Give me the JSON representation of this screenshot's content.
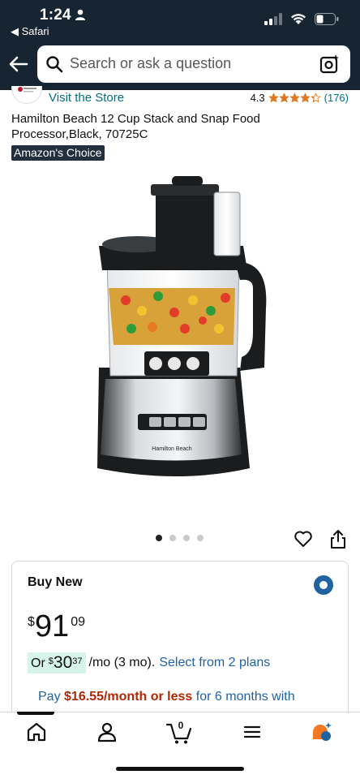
{
  "status_bar": {
    "time": "1:24",
    "back_app": "◀ Safari"
  },
  "search": {
    "placeholder": "Search or ask a question"
  },
  "store": {
    "link": "Visit the Store"
  },
  "rating": {
    "value": "4.3",
    "stars": 4.3,
    "count": "(176)"
  },
  "product": {
    "title": "Hamilton Beach 12 Cup Stack and Snap Food Processor,Black, 70725C",
    "badge": "Amazon's Choice",
    "image_brand": "Hamilton Beach",
    "image_count": 4,
    "image_current": 1
  },
  "buy_box": {
    "title": "Buy New",
    "price": {
      "symbol": "$",
      "whole": "91",
      "fraction": "09"
    },
    "monthly": {
      "prefix": "Or",
      "symbol": "$",
      "whole": "30",
      "fraction": "37",
      "suffix": "/mo (3 mo).",
      "link": "Select from 2 plans"
    },
    "pay": {
      "prefix": "Pay",
      "amount": "$16.55/month or less",
      "suffix": "for 6 months with"
    }
  },
  "bottom_nav": {
    "cart_count": "0",
    "items": [
      "home-icon",
      "account-icon",
      "cart-icon",
      "menu-icon",
      "rufus-icon"
    ]
  },
  "colors": {
    "header": "#172432",
    "link": "#007185",
    "accent_blue": "#2162a1",
    "star": "#de7921",
    "deal_red": "#b12704",
    "monthly_highlight": "#d6f4e9",
    "rufus_orange": "#f3781f"
  }
}
